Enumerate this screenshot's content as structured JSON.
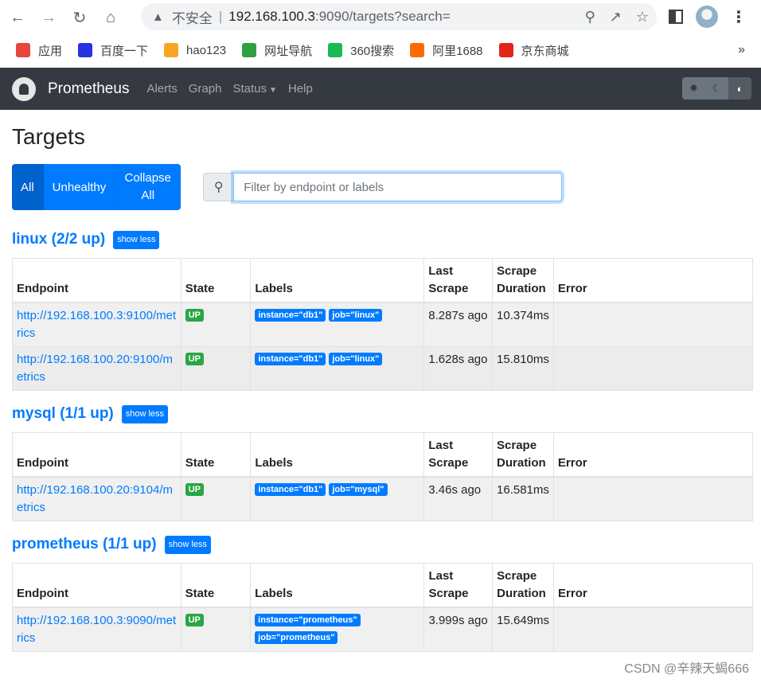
{
  "browser": {
    "insecure_label": "不安全",
    "url_host": "192.168.100.3",
    "url_path": ":9090/targets?search=",
    "bookmarks": [
      {
        "label": "应用",
        "color": "#e8453c"
      },
      {
        "label": "百度一下",
        "color": "#2932e1"
      },
      {
        "label": "hao123",
        "color": "#f6a623"
      },
      {
        "label": "网址导航",
        "color": "#2ea043"
      },
      {
        "label": "360搜索",
        "color": "#19b955"
      },
      {
        "label": "阿里1688",
        "color": "#ff6a00"
      },
      {
        "label": "京东商城",
        "color": "#e1251b"
      }
    ],
    "more": "»"
  },
  "navbar": {
    "brand": "Prometheus",
    "links": [
      "Alerts",
      "Graph",
      "Status",
      "Help"
    ]
  },
  "page": {
    "title": "Targets",
    "filters": {
      "all": "All",
      "unhealthy": "Unhealthy",
      "collapse": "Collapse All"
    },
    "search_placeholder": "Filter by endpoint or labels",
    "show_less": "show less",
    "columns": {
      "endpoint": "Endpoint",
      "state": "State",
      "labels": "Labels",
      "last_scrape": "Last Scrape",
      "scrape_duration": "Scrape Duration",
      "error": "Error"
    }
  },
  "pools": [
    {
      "title": "linux (2/2 up)",
      "targets": [
        {
          "endpoint": "http://192.168.100.3:9100/metrics",
          "state": "UP",
          "labels": [
            "instance=\"db1\"",
            "job=\"linux\""
          ],
          "last_scrape": "8.287s ago",
          "duration": "10.374ms",
          "error": ""
        },
        {
          "endpoint": "http://192.168.100.20:9100/metrics",
          "state": "UP",
          "labels": [
            "instance=\"db1\"",
            "job=\"linux\""
          ],
          "last_scrape": "1.628s ago",
          "duration": "15.810ms",
          "error": ""
        }
      ]
    },
    {
      "title": "mysql (1/1 up)",
      "targets": [
        {
          "endpoint": "http://192.168.100.20:9104/metrics",
          "state": "UP",
          "labels": [
            "instance=\"db1\"",
            "job=\"mysql\""
          ],
          "last_scrape": "3.46s ago",
          "duration": "16.581ms",
          "error": ""
        }
      ]
    },
    {
      "title": "prometheus (1/1 up)",
      "targets": [
        {
          "endpoint": "http://192.168.100.3:9090/metrics",
          "state": "UP",
          "labels": [
            "instance=\"prometheus\"",
            "job=\"prometheus\""
          ],
          "last_scrape": "3.999s ago",
          "duration": "15.649ms",
          "error": ""
        }
      ]
    }
  ],
  "watermark": "CSDN @辛辣天蝎666"
}
